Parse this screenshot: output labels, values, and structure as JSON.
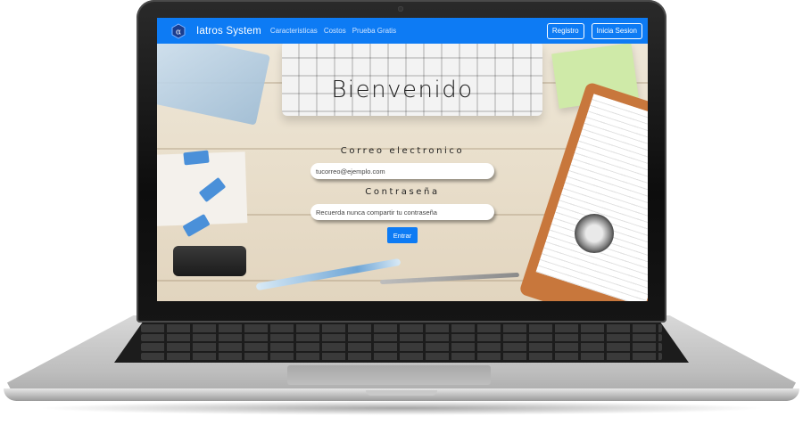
{
  "navbar": {
    "brand_name": "Iatros System",
    "logo_icon": "alpha-hexagon-icon",
    "links": [
      "Caracteristicas",
      "Costos",
      "Prueba Gratis"
    ],
    "register_label": "Registro",
    "login_label": "Inicia Sesion",
    "color": "#0d7bf4"
  },
  "login": {
    "welcome": "Bienvenido",
    "email_label": "Correo electronico",
    "email_placeholder": "tucorreo@ejemplo.com",
    "password_label": "Contraseña",
    "password_placeholder": "Recuerda nunca compartir tu contraseña",
    "submit_label": "Entrar"
  }
}
